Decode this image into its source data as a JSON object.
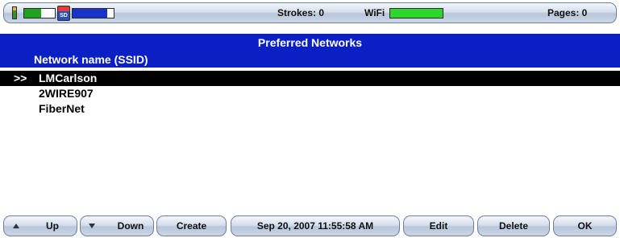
{
  "status_bar": {
    "battery_level": 0.55,
    "sd_label": "SD",
    "storage_level": 0.85,
    "strokes_text": "Strokes: 0",
    "wifi_label": "WiFi",
    "wifi_level": 1.0,
    "pages_text": "Pages: 0",
    "colors": {
      "battery": "#1fa31f",
      "storage": "#1834c8",
      "wifi": "#2dd62d"
    }
  },
  "header": {
    "title": "Preferred Networks",
    "column_label": "Network name (SSID)",
    "background": "#0b20c4"
  },
  "networks": [
    {
      "marker": ">>",
      "name": "LMCarlson",
      "selected": true
    },
    {
      "marker": "",
      "name": "2WIRE907",
      "selected": false
    },
    {
      "marker": "",
      "name": "FiberNet",
      "selected": false
    }
  ],
  "toolbar": {
    "up_label": "Up",
    "up_icon": "triangle-up-icon",
    "down_label": "Down",
    "down_icon": "triangle-down-icon",
    "create_label": "Create",
    "datetime_label": "Sep 20, 2007  11:55:58 AM",
    "edit_label": "Edit",
    "delete_label": "Delete",
    "ok_label": "OK"
  }
}
